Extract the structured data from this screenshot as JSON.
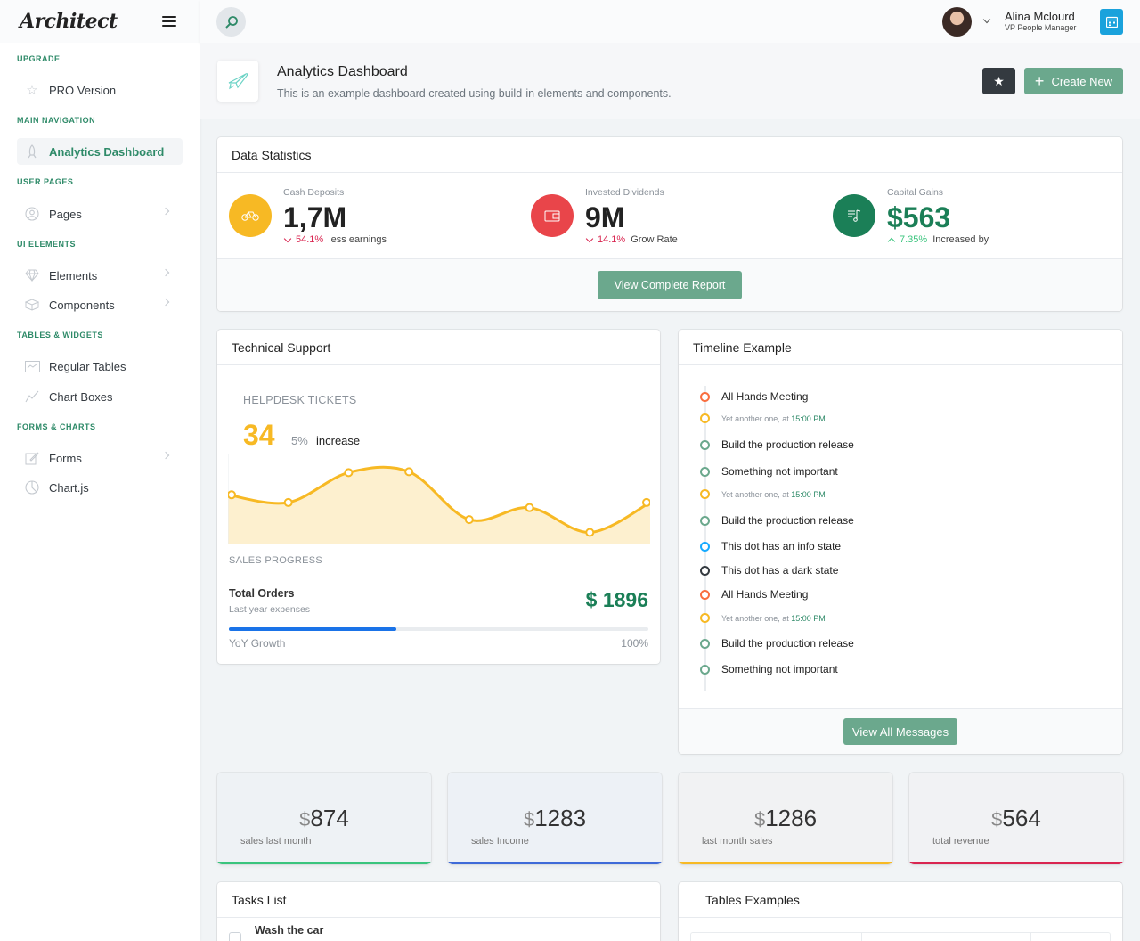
{
  "sidebar": {
    "logo": "Architect",
    "sections": [
      {
        "heading": "UPGRADE",
        "items": [
          {
            "label": "PRO Version",
            "icon": "star-icon"
          }
        ]
      },
      {
        "heading": "MAIN NAVIGATION",
        "items": [
          {
            "label": "Analytics Dashboard",
            "icon": "rocket-icon",
            "active": true
          }
        ]
      },
      {
        "heading": "USER PAGES",
        "items": [
          {
            "label": "Pages",
            "icon": "users-icon"
          }
        ]
      },
      {
        "heading": "UI ELEMENTS",
        "items": [
          {
            "label": "Elements",
            "icon": "diamond-icon"
          },
          {
            "label": "Components",
            "icon": "box-icon"
          }
        ]
      },
      {
        "heading": "TABLES & WIDGETS",
        "items": [
          {
            "label": "Regular Tables",
            "icon": "table-icon"
          },
          {
            "label": "Chart Boxes",
            "icon": "graph-icon"
          }
        ]
      },
      {
        "heading": "FORMS & CHARTS",
        "items": [
          {
            "label": "Forms",
            "icon": "pencil-icon"
          },
          {
            "label": "Chart.js",
            "icon": "pie-icon"
          }
        ]
      }
    ]
  },
  "header": {
    "user_name": "Alina Mclourd",
    "user_role": "VP People Manager"
  },
  "page": {
    "title": "Analytics Dashboard",
    "subtitle": "This is an example dashboard created using build-in elements and components.",
    "create_label": "Create New"
  },
  "stats": {
    "title": "Data Statistics",
    "items": [
      {
        "label": "Cash Deposits",
        "value": "1,7M",
        "pct": "54.1%",
        "note": "less earnings",
        "color": "#f7b924"
      },
      {
        "label": "Invested Dividends",
        "value": "9M",
        "pct": "14.1%",
        "note": "Grow Rate",
        "color": "#d92550"
      },
      {
        "label": "Capital Gains",
        "value": "$563",
        "pct": "7.35%",
        "note": "Increased by",
        "color": "#3ac47d"
      }
    ],
    "button": "View Complete Report"
  },
  "support": {
    "title": "Technical Support",
    "helpdesk_label": "HELPDESK TICKETS",
    "tickets": "34",
    "pct": "5%",
    "pct_note": "increase",
    "sales_label": "SALES PROGRESS",
    "orders_title": "Total Orders",
    "orders_sub": "Last year expenses",
    "orders_value": "$ 1896",
    "growth_label": "YoY Growth",
    "growth_pct": "100%",
    "progress": 0.4
  },
  "chart_data": {
    "type": "area",
    "x": [
      1,
      2,
      3,
      4,
      5,
      6,
      7,
      8
    ],
    "values": [
      57,
      48,
      83,
      84,
      28,
      42,
      13,
      48
    ],
    "ylim": [
      0,
      100
    ],
    "color": "#f7b924"
  },
  "timeline": {
    "title": "Timeline Example",
    "items": [
      {
        "text": "All Hands Meeting",
        "color": "#f96e3f",
        "small": false
      },
      {
        "text": "Yet another one, at ",
        "time": "15:00 PM",
        "color": "#f7b924",
        "small": true
      },
      {
        "text": "Build the production release",
        "color": "#6ba88d",
        "small": false
      },
      {
        "text": "Something not important",
        "color": "#6ba88d",
        "small": false
      },
      {
        "text": "Yet another one, at ",
        "time": "15:00 PM",
        "color": "#f7b924",
        "small": true
      },
      {
        "text": "Build the production release",
        "color": "#6ba88d",
        "small": false
      },
      {
        "text": "This dot has an info state",
        "color": "#16aaff",
        "small": false
      },
      {
        "text": "This dot has a dark state",
        "color": "#343a40",
        "small": false
      },
      {
        "text": "All Hands Meeting",
        "color": "#f96e3f",
        "small": false
      },
      {
        "text": "Yet another one, at ",
        "time": "15:00 PM",
        "color": "#f7b924",
        "small": true
      },
      {
        "text": "Build the production release",
        "color": "#6ba88d",
        "small": false
      },
      {
        "text": "Something not important",
        "color": "#6ba88d",
        "small": false
      }
    ],
    "button": "View All Messages"
  },
  "widgets": [
    {
      "currency": "$",
      "value": "874",
      "label": "sales last month",
      "color": "#3ac47d",
      "bg": "#eef2f5"
    },
    {
      "currency": "$",
      "value": "1283",
      "label": "sales Income",
      "color": "#3f6ad8",
      "bg": "#edf1f6"
    },
    {
      "currency": "$",
      "value": "1286",
      "label": "last month sales",
      "color": "#f7b924",
      "bg": "#f1f2f3"
    },
    {
      "currency": "$",
      "value": "564",
      "label": "total revenue",
      "color": "#d92550",
      "bg": "#f1f2f4"
    }
  ],
  "tasks": {
    "title": "Tasks List",
    "first_task": "Wash the car"
  },
  "tables": {
    "title": "Tables Examples"
  }
}
